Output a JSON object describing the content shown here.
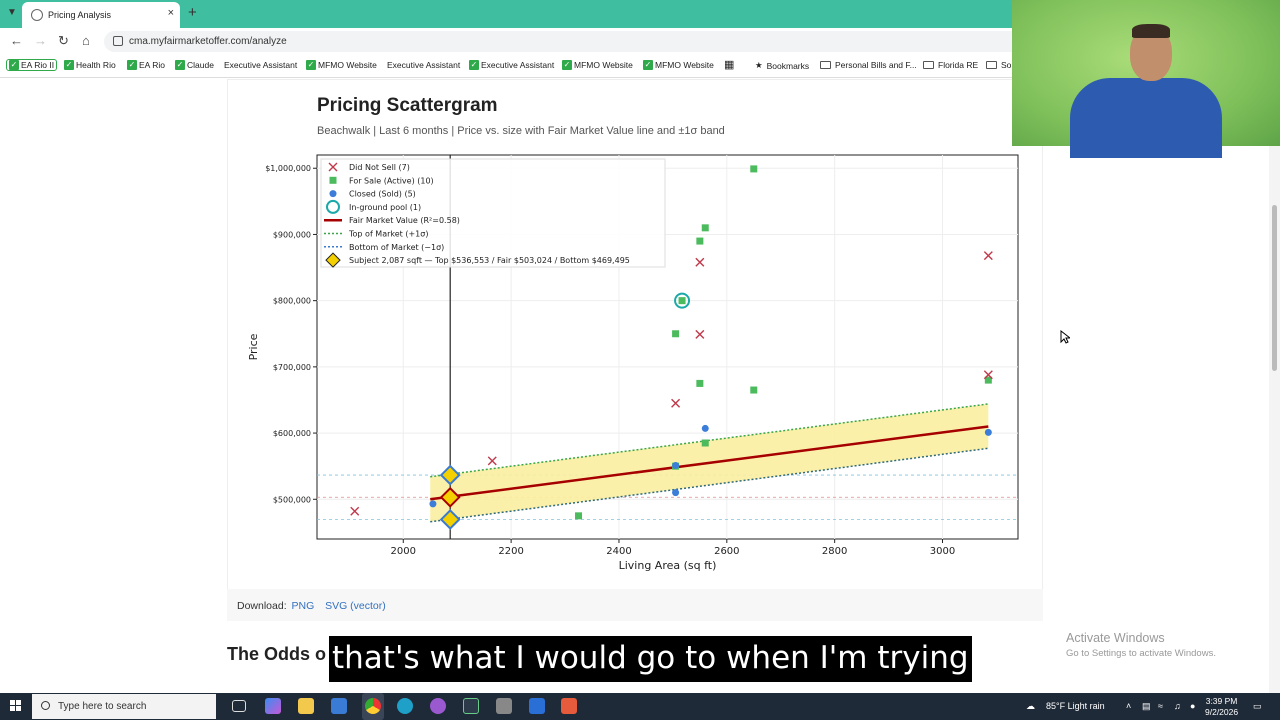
{
  "browser": {
    "tab_title": "Pricing Analysis",
    "tab_close": "×",
    "new_tab": "+",
    "url": "cma.myfairmarketoffer.com/analyze",
    "bookmarks": [
      {
        "label": "EA Rio II",
        "icon": "check"
      },
      {
        "label": "Health Rio",
        "icon": "check"
      },
      {
        "label": "EA Rio",
        "icon": "check"
      },
      {
        "label": "Claude",
        "icon": "check"
      },
      {
        "label": "Executive Assistant",
        "icon": "none"
      },
      {
        "label": "MFMO Website",
        "icon": "check"
      },
      {
        "label": "Executive Assistant",
        "icon": "none"
      },
      {
        "label": "Executive Assistant",
        "icon": "check"
      },
      {
        "label": "MFMO Website",
        "icon": "check"
      },
      {
        "label": "MFMO Website",
        "icon": "check"
      },
      {
        "label": "Bookmarks",
        "icon": "star"
      },
      {
        "label": "Personal Bills and F...",
        "icon": "folder"
      },
      {
        "label": "Florida RE",
        "icon": "folder"
      },
      {
        "label": "So",
        "icon": "folder"
      }
    ]
  },
  "page": {
    "title": "Pricing Scattergram",
    "subtitle": "Beachwalk  |  Last 6 months  |  Price vs. size with Fair Market Value line and ±1σ band",
    "download_label": "Download:",
    "download_png": "PNG",
    "download_svg": "SVG (vector)",
    "next_heading": "The Odds o"
  },
  "overlay": {
    "caption": "that's what I would go to when I'm trying",
    "watermark_title": "Activate Windows",
    "watermark_sub": "Go to Settings to activate Windows."
  },
  "taskbar": {
    "search_placeholder": "Type here to search",
    "weather": "85°F  Light rain",
    "time": "3:39 PM",
    "date": "9/2/2026"
  },
  "chart_data": {
    "type": "scatter",
    "xlabel": "Living Area (sq ft)",
    "ylabel": "Price",
    "xlim": [
      1840,
      3140
    ],
    "ylim": [
      440000,
      1020000
    ],
    "xticks": [
      2000,
      2200,
      2400,
      2600,
      2800,
      3000
    ],
    "yticks": [
      500000,
      600000,
      700000,
      800000,
      900000,
      1000000
    ],
    "ytick_labels": [
      "$500,000",
      "$600,000",
      "$700,000",
      "$800,000",
      "$900,000",
      "$1,000,000"
    ],
    "grid": true,
    "legend_position": "top-left",
    "legend": [
      "Did Not Sell (7)",
      "For Sale (Active) (10)",
      "Closed (Sold) (5)",
      "In-ground pool (1)",
      "Fair Market Value (R²=0.58)",
      "Top of Market (+1σ)",
      "Bottom of Market (−1σ)",
      "Subject 2,087 sqft  —  Top $536,553 / Fair $503,024 / Bottom $469,495"
    ],
    "colors": {
      "did_not_sell": "#c0394b",
      "for_sale": "#4cbb5e",
      "closed": "#3b7dd8",
      "pool": "#1ba8a8",
      "fmv": "#a60000",
      "band": "#fbeea0",
      "subject": "#f5d000"
    },
    "did_not_sell": [
      [
        1910,
        482000
      ],
      [
        2165,
        558000
      ],
      [
        2505,
        645000
      ],
      [
        2550,
        858000
      ],
      [
        2550,
        749000
      ],
      [
        3085,
        868000
      ],
      [
        3085,
        688000
      ]
    ],
    "for_sale": [
      [
        2325,
        475000
      ],
      [
        2505,
        750000
      ],
      [
        2550,
        675000
      ],
      [
        2550,
        890000
      ],
      [
        2560,
        910000
      ],
      [
        2560,
        585000
      ],
      [
        2650,
        999000
      ],
      [
        2650,
        665000
      ],
      [
        3085,
        680000
      ],
      [
        2505,
        550000
      ]
    ],
    "closed": [
      [
        2055,
        493000
      ],
      [
        2505,
        510000
      ],
      [
        2505,
        551000
      ],
      [
        2560,
        607000
      ],
      [
        3085,
        601000
      ]
    ],
    "pool": [
      [
        2517,
        800000
      ]
    ],
    "fmv_line": {
      "x": [
        2050,
        3085
      ],
      "y": [
        500000,
        610000
      ]
    },
    "top_line": {
      "x": [
        2050,
        3085
      ],
      "y": [
        534000,
        644000
      ]
    },
    "bottom_line": {
      "x": [
        2050,
        3085
      ],
      "y": [
        466000,
        577000
      ]
    },
    "subject": {
      "sqft": 2087,
      "top": 536553,
      "fair": 503024,
      "bottom": 469495
    }
  }
}
